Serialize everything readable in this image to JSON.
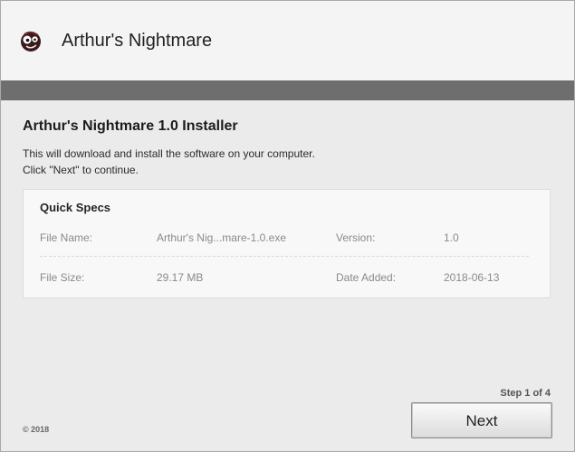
{
  "header": {
    "app_icon": "skull-icon",
    "title": "Arthur's Nightmare"
  },
  "main": {
    "heading": "Arthur's Nightmare 1.0 Installer",
    "description_line1": "This will download and install the software on your computer.",
    "description_line2": "Click \"Next\" to continue."
  },
  "specs": {
    "title": "Quick Specs",
    "file_name_label": "File Name:",
    "file_name_value": "Arthur's Nig...mare-1.0.exe",
    "version_label": "Version:",
    "version_value": "1.0",
    "file_size_label": "File Size:",
    "file_size_value": "29.17 MB",
    "date_added_label": "Date Added:",
    "date_added_value": "2018-06-13"
  },
  "footer": {
    "step_text": "Step 1 of 4",
    "copyright": "© 2018",
    "next_label": "Next"
  },
  "colors": {
    "band": "#6e6e6e",
    "background": "#ebebeb",
    "header_background": "#f4f4f4"
  }
}
